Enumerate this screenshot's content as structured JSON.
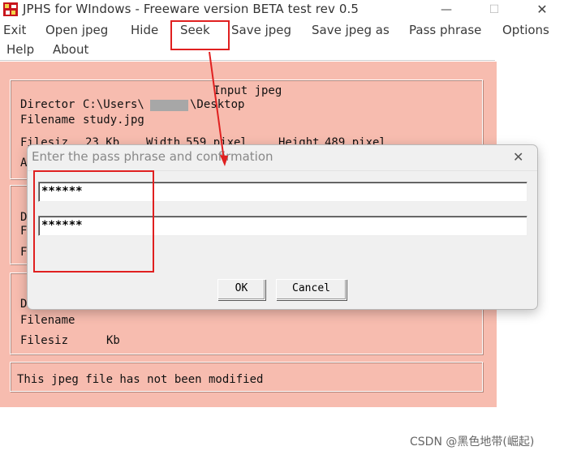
{
  "window": {
    "title": "JPHS for WIndows - Freeware version BETA test rev 0.5",
    "minimize_glyph": "—",
    "maximize_glyph": "☐",
    "close_glyph": "✕"
  },
  "menu": {
    "exit": "Exit",
    "open_jpeg": "Open jpeg",
    "hide": "Hide",
    "seek": "Seek",
    "save_jpeg": "Save jpeg",
    "save_jpeg_as": "Save jpeg as",
    "pass_phrase": "Pass phrase",
    "options": "Options",
    "help": "Help",
    "about": "About"
  },
  "input_group": {
    "header": "Input jpeg",
    "directory_label": "Director",
    "directory_value": "C:\\Users\\",
    "directory_suffix": "\\Desktop",
    "filename_label": "Filename",
    "filename_value": "study.jpg",
    "filesize_label": "Filesiz",
    "filesize_value": "23 Kb",
    "width_label": "Width",
    "width_value": "559 pixel",
    "height_label": "Height",
    "height_value": "489 pixel",
    "row4_label": "A"
  },
  "hidden_group": {
    "row1_label": "D",
    "row2_label": "F",
    "row3_label": "F"
  },
  "output_group": {
    "directory_label": "D",
    "filename_label": "Filename",
    "filesize_label": "Filesiz",
    "filesize_unit": "Kb"
  },
  "status": {
    "message": "This jpeg file has not been modified"
  },
  "dialog": {
    "title": "Enter the pass phrase and confirmation",
    "close_glyph": "✕",
    "pass_phrase_value": "******",
    "confirmation_value": "******",
    "ok_label": "OK",
    "cancel_label": "Cancel"
  },
  "annotation_color": "#e02020",
  "panel_color": "#f7bcaf",
  "watermark": "CSDN @黑色地带(崛起)"
}
